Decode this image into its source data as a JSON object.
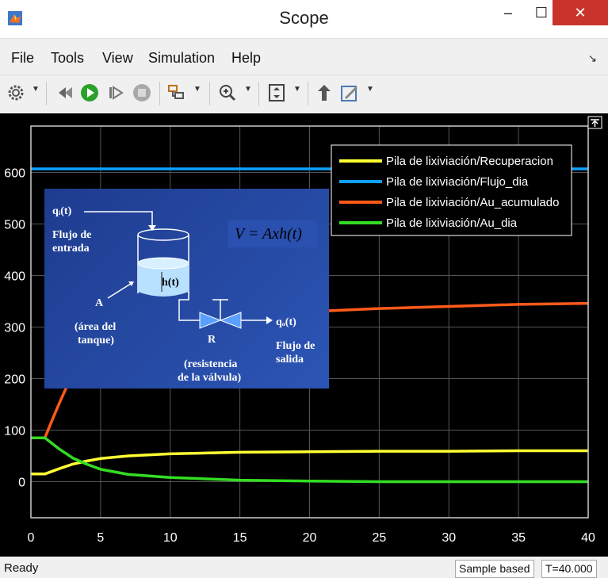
{
  "window": {
    "title": "Scope",
    "minimize": "–",
    "maximize": "☐",
    "close": "✕"
  },
  "menu": {
    "items": [
      "File",
      "Tools",
      "View",
      "Simulation",
      "Help"
    ],
    "corner": "↘"
  },
  "toolbar": {
    "icons": [
      "gear-icon",
      "rewind-icon",
      "run-icon",
      "step-forward-icon",
      "stop-icon",
      "signal-select-icon",
      "zoom-icon",
      "autoscale-icon",
      "highlight-icon",
      "style-icon"
    ]
  },
  "status": {
    "left": "Ready",
    "sample": "Sample based",
    "time": "T=40.000"
  },
  "colors": {
    "background": "#000000",
    "grid": "#555555",
    "yellow": "#ffff33",
    "blue": "#0ea0ff",
    "orange": "#ff5a1a",
    "green": "#33dd22"
  },
  "inset": {
    "qi": "qᵢ(t)",
    "flujo_entrada": [
      "Flujo de",
      "entrada"
    ],
    "h": "h(t)",
    "A": "A",
    "area": [
      "(área del",
      "tanque)"
    ],
    "R": "R",
    "resistencia": [
      "(resistencia",
      "de la válvula)"
    ],
    "qo": "qₒ(t)",
    "flujo_salida": [
      "Flujo de",
      "salida"
    ],
    "equation": "V = Axh(t)"
  },
  "chart_data": {
    "type": "line",
    "xlim": [
      0,
      40
    ],
    "ylim": [
      -70,
      690
    ],
    "xticks": [
      0,
      5,
      10,
      15,
      20,
      25,
      30,
      35,
      40
    ],
    "yticks": [
      0,
      100,
      200,
      300,
      400,
      500,
      600
    ],
    "grid": true,
    "legend_position": "top-right",
    "series": [
      {
        "name": "Pila de lixiviación/Recuperacion",
        "color": "#ffff33",
        "x": [
          0,
          1,
          2,
          3,
          4,
          5,
          7,
          10,
          15,
          20,
          25,
          30,
          35,
          40
        ],
        "y": [
          15,
          15,
          25,
          34,
          40,
          45,
          50,
          54,
          57,
          58,
          59,
          59,
          60,
          60
        ]
      },
      {
        "name": "Pila de lixiviación/Flujo_dia",
        "color": "#0ea0ff",
        "x": [
          0,
          40
        ],
        "y": [
          607,
          607
        ]
      },
      {
        "name": "Pila de lixiviación/Au_acumulado",
        "color": "#ff5a1a",
        "x": [
          0,
          1,
          1.5,
          2,
          2.5,
          3,
          5,
          10,
          15,
          20,
          25,
          30,
          35,
          40
        ],
        "y": [
          85,
          85,
          118,
          150,
          180,
          200,
          250,
          300,
          320,
          330,
          336,
          340,
          344,
          346
        ]
      },
      {
        "name": "Pila de lixiviación/Au_dia",
        "color": "#33dd22",
        "x": [
          0,
          1,
          2,
          3,
          4,
          5,
          7,
          10,
          15,
          20,
          25,
          30,
          35,
          40
        ],
        "y": [
          85,
          85,
          64,
          46,
          34,
          24,
          14,
          8,
          3,
          1,
          0,
          0,
          0,
          0
        ]
      }
    ]
  }
}
